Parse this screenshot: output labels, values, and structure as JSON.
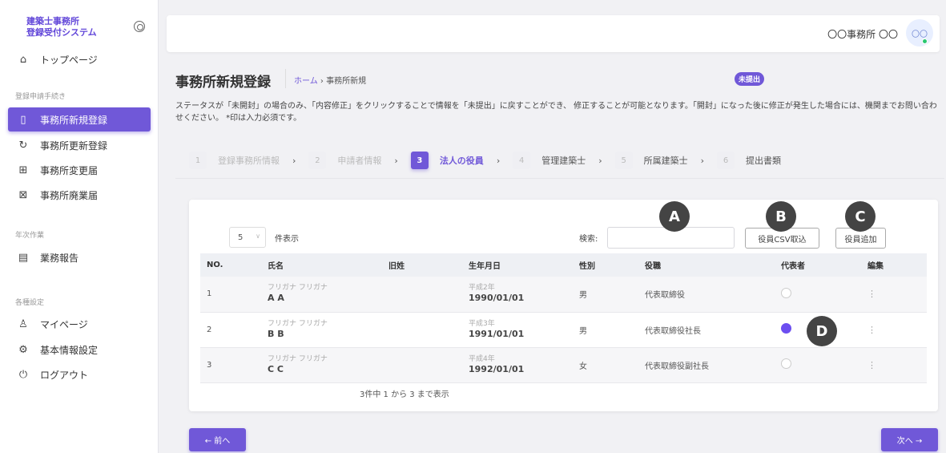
{
  "brand": {
    "line1": "建築士事務所",
    "line2": "登録受付システム"
  },
  "sidebar": {
    "top_item": {
      "label": "トップページ",
      "icon": "home-icon"
    },
    "section1": "登録申請手続き",
    "items": [
      {
        "label": "事務所新規登録",
        "icon": "document-icon"
      },
      {
        "label": "事務所更新登録",
        "icon": "refresh-icon"
      },
      {
        "label": "事務所変更届",
        "icon": "document-plus-icon"
      },
      {
        "label": "事務所廃業届",
        "icon": "document-x-icon"
      }
    ],
    "section2": "年次作業",
    "annual": {
      "label": "業務報告",
      "icon": "report-icon"
    },
    "section3": "各種設定",
    "settings": [
      {
        "label": "マイページ",
        "icon": "user-icon"
      },
      {
        "label": "基本情報設定",
        "icon": "gear-icon"
      },
      {
        "label": "ログアウト",
        "icon": "power-icon"
      }
    ]
  },
  "topbar": {
    "user": "〇〇事務所 〇〇",
    "avatar": "〇〇"
  },
  "header": {
    "title": "事務所新規登録",
    "breadcrumb_home": "ホーム",
    "breadcrumb_sep": "›",
    "breadcrumb_current": "事務所新規",
    "status": "未提出",
    "notice": "ステータスが「未開封」の場合のみ、「内容修正」をクリックすることで情報を「未提出」に戻すことができ、 修正することが可能となります。「開封」になった後に修正が発生した場合には、機関までお問い合わせください。 *印は入力必須です。"
  },
  "steps": [
    {
      "num": "1",
      "label": "登録事務所情報"
    },
    {
      "num": "2",
      "label": "申請者情報"
    },
    {
      "num": "3",
      "label": "法人の役員"
    },
    {
      "num": "4",
      "label": "管理建築士"
    },
    {
      "num": "5",
      "label": "所属建築士"
    },
    {
      "num": "6",
      "label": "提出書類"
    }
  ],
  "step_arrow": "›",
  "table_controls": {
    "page_length": "5",
    "length_suffix": "件表示",
    "search_label": "検索:",
    "search_value": "",
    "csv_button": "役員CSV取込",
    "add_button": "役員追加"
  },
  "columns": [
    "NO.",
    "氏名",
    "旧姓",
    "生年月日",
    "性別",
    "役職",
    "代表者",
    "編集"
  ],
  "rows": [
    {
      "no": "1",
      "kana": "フリガナ フリガナ",
      "name": "A A",
      "old_name": "",
      "era": "平成2年",
      "dob": "1990/01/01",
      "gender": "男",
      "role": "代表取締役",
      "representative": false
    },
    {
      "no": "2",
      "kana": "フリガナ フリガナ",
      "name": "B B",
      "old_name": "",
      "era": "平成3年",
      "dob": "1991/01/01",
      "gender": "男",
      "role": "代表取締役社長",
      "representative": true
    },
    {
      "no": "3",
      "kana": "フリガナ フリガナ",
      "name": "C C",
      "old_name": "",
      "era": "平成4年",
      "dob": "1992/01/01",
      "gender": "女",
      "role": "代表取締役副社長",
      "representative": false
    }
  ],
  "table_info": "3件中 1 から 3 まで表示",
  "callouts": {
    "a": "A",
    "b": "B",
    "c": "C",
    "d": "D"
  },
  "pager": {
    "prev": "← 前へ",
    "next": "次へ →"
  },
  "colors": {
    "accent": "#7058d8",
    "callout": "#444444",
    "online": "#28c76f"
  }
}
